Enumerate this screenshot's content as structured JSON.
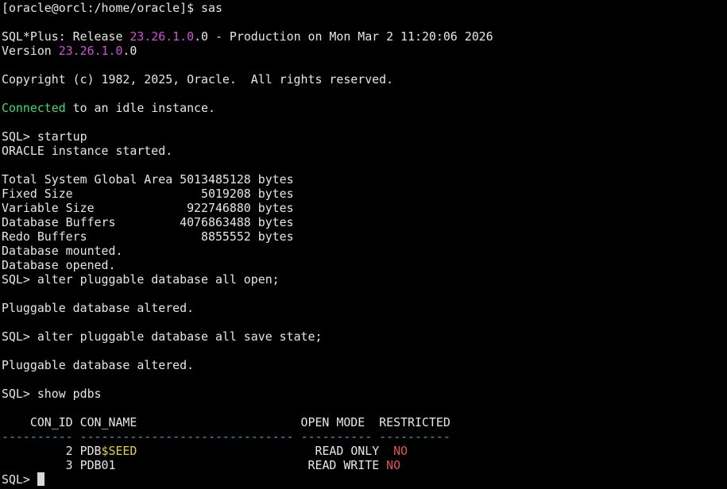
{
  "terminal": {
    "shell_prompt": "[oracle@orcl:/home/oracle]$ ",
    "shell_command": "sas",
    "sqlplus": {
      "banner_prefix": "SQL*Plus: Release ",
      "release_version": "23.26.1.0",
      "release_suffix": ".0 - Production on Mon Mar 2 11:20:06 2026",
      "version_prefix": "Version ",
      "version": "23.26.1.0",
      "version_suffix": ".0",
      "copyright": "Copyright (c) 1982, 2025, Oracle.  All rights reserved.",
      "connected_word": "Connected",
      "connected_rest": " to an idle instance."
    },
    "sql_prompt": "SQL> ",
    "startup": {
      "command": "startup",
      "started": "ORACLE instance started.",
      "sga": [
        "Total System Global Area 5013485128 bytes",
        "Fixed Size                  5019208 bytes",
        "Variable Size             922746880 bytes",
        "Database Buffers         4076863488 bytes",
        "Redo Buffers                8855552 bytes"
      ],
      "mounted": "Database mounted.",
      "opened": "Database opened."
    },
    "commands": {
      "open_all": "alter pluggable database all open;",
      "save_state": "alter pluggable database all save state;",
      "show_pdbs": "show pdbs"
    },
    "altered_message": "Pluggable database altered.",
    "pdbs_table": {
      "header": "    CON_ID CON_NAME                       OPEN MODE  RESTRICTED",
      "sep_id": "----------",
      "sep_name": "------------------------------",
      "sep_mode": "----------",
      "sep_restricted": "----------",
      "rows": [
        {
          "con_id_cell": "         2",
          "name_plain": "PDB",
          "name_highlight": "$SEED",
          "name_pad": "                        ",
          "open_mode": "READ ONLY",
          "mode_pad": "  ",
          "restricted": "NO"
        },
        {
          "con_id_cell": "         3",
          "name_plain": "PDB01",
          "name_highlight": "",
          "name_pad": "                          ",
          "open_mode": "READ WRITE",
          "mode_pad": " ",
          "restricted": "NO"
        }
      ]
    }
  }
}
